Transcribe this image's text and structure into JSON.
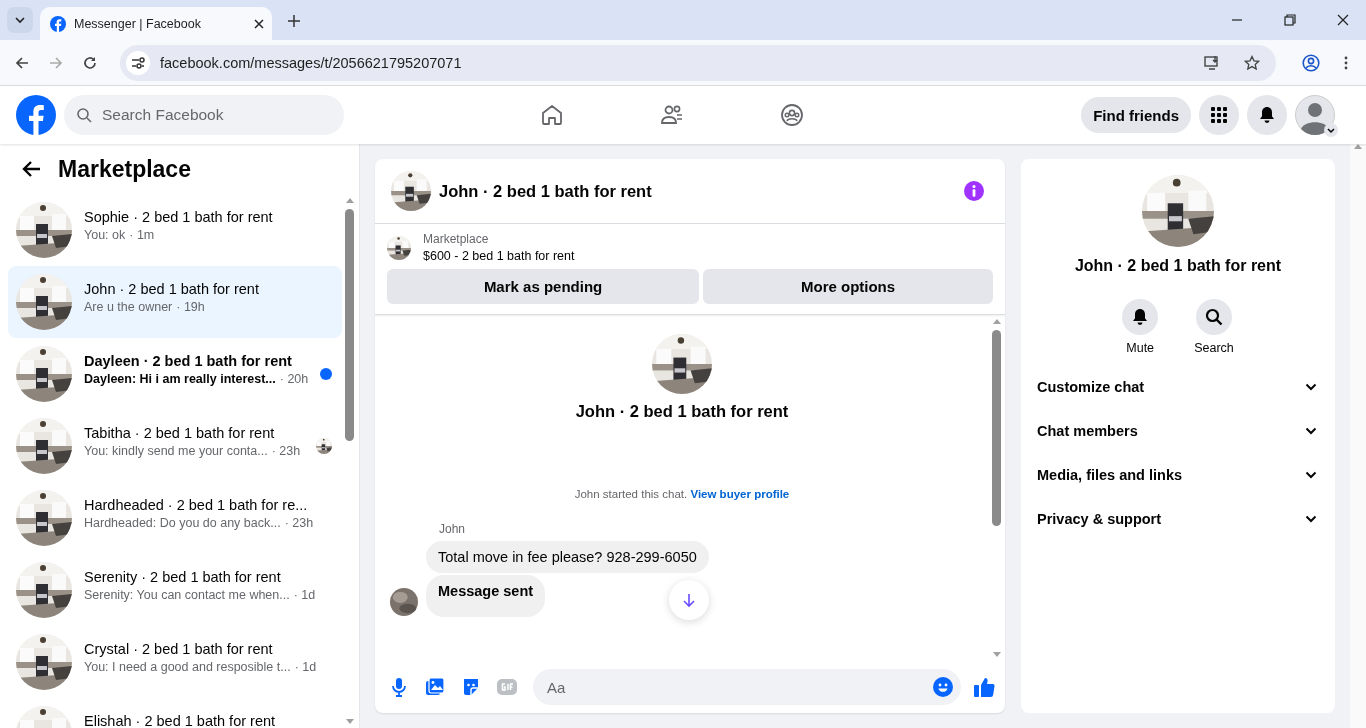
{
  "browser": {
    "tab_title": "Messenger | Facebook",
    "url": "facebook.com/messages/t/2056621795207071"
  },
  "header": {
    "search_placeholder": "Search Facebook",
    "find_friends": "Find friends"
  },
  "sidebar": {
    "title": "Marketplace",
    "conversations": [
      {
        "name": "Sophie · 2 bed 1 bath for rent",
        "preview": "You: ok",
        "time": "· 1m",
        "selected": false,
        "unread": false
      },
      {
        "name": "John · 2 bed 1 bath for rent",
        "preview": "Are u the owner",
        "time": "· 19h",
        "selected": true,
        "unread": false
      },
      {
        "name": "Dayleen · 2 bed 1 bath for rent",
        "preview": "Dayleen: Hi i am really interest...",
        "time": "· 20h",
        "selected": false,
        "unread": true
      },
      {
        "name": "Tabitha · 2 bed 1 bath for rent",
        "preview": "You: kindly send me your conta...",
        "time": "· 23h",
        "selected": false,
        "unread": false,
        "seen": true
      },
      {
        "name": "Hardheaded · 2 bed 1 bath for re...",
        "preview": "Hardheaded: Do you do any back...",
        "time": "· 23h",
        "selected": false,
        "unread": false
      },
      {
        "name": "Serenity · 2 bed 1 bath for rent",
        "preview": "Serenity: You can contact me when...",
        "time": "· 1d",
        "selected": false,
        "unread": false
      },
      {
        "name": "Crystal · 2 bed 1 bath for rent",
        "preview": "You: I need a good and resposible t...",
        "time": "· 1d",
        "selected": false,
        "unread": false
      },
      {
        "name": "Elishah · 2 bed 1 bath for rent",
        "selected": false,
        "unread": false
      }
    ]
  },
  "chat": {
    "title": "John · 2 bed 1 bath for rent",
    "listing": {
      "label": "Marketplace",
      "title": "$600 - 2 bed 1 bath for rent"
    },
    "buttons": [
      "Mark as pending",
      "More options"
    ],
    "intro_name": "John · 2 bed 1 bath for rent",
    "note": {
      "text": "John started this chat.",
      "link": "View buyer profile"
    },
    "sender": "John",
    "messages": [
      {
        "text": "Total move in fee please? 928-299-6050",
        "bold": false
      },
      {
        "text": "Message sent",
        "bold": true
      }
    ],
    "composer_placeholder": "Aa"
  },
  "details": {
    "name": "John · 2 bed 1 bath for rent",
    "actions": [
      {
        "kind": "mute",
        "label": "Mute"
      },
      {
        "kind": "search",
        "label": "Search"
      }
    ],
    "sections": [
      "Customize chat",
      "Chat members",
      "Media, files and links",
      "Privacy & support"
    ]
  }
}
